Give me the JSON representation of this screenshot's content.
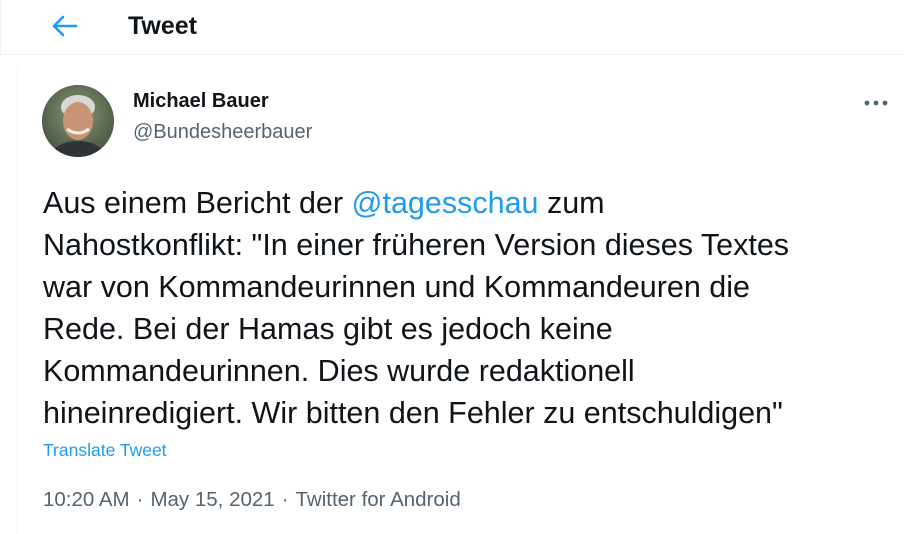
{
  "header": {
    "title": "Tweet",
    "back_icon": "arrow-left-icon",
    "accent": "#1d9bf0"
  },
  "author": {
    "name": "Michael Bauer",
    "handle": "@Bundesheerbauer"
  },
  "tweet": {
    "text_before_mention": "Aus einem Bericht der ",
    "mention": "@tagesschau",
    "text_after_mention": " zum\nNahostkonflikt: \"In einer früheren Version dieses Textes\nwar von Kommandeurinnen und Kommandeuren die\nRede. Bei der Hamas gibt es jedoch keine\nKommandeurinnen. Dies wurde redaktionell\nhineinredigiert. Wir bitten den Fehler zu entschuldigen\"",
    "translate_label": "Translate Tweet"
  },
  "meta": {
    "time": "10:20 AM",
    "separator": "·",
    "date": "May 15, 2021",
    "source": "Twitter for Android"
  }
}
